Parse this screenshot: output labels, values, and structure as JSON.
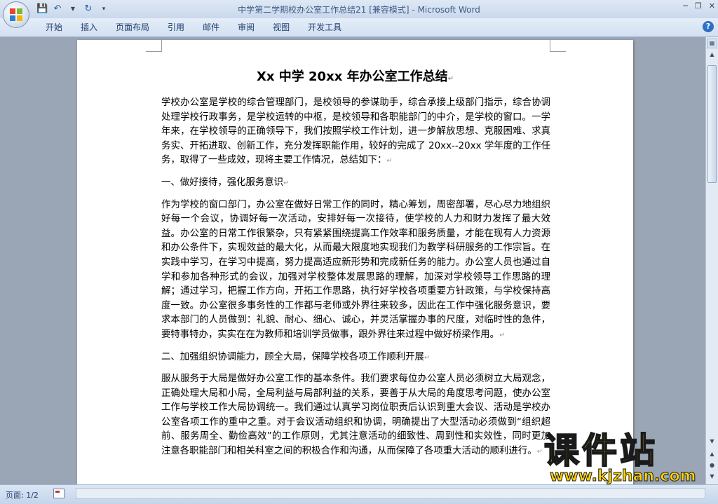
{
  "window": {
    "title": "中学第二学期校办公室工作总结21 [兼容模式]",
    "app_name": "Microsoft Word",
    "separator": " - "
  },
  "ribbon": {
    "tabs": [
      "开始",
      "插入",
      "页面布局",
      "引用",
      "邮件",
      "审阅",
      "视图",
      "开发工具"
    ]
  },
  "document": {
    "title": "Xx 中学 20xx 年办公室工作总结",
    "paragraphs": [
      "学校办公室是学校的综合管理部门，是校领导的参谋助手，综合承接上级部门指示，综合协调处理学校行政事务，是学校运转的中枢，是校领导和各职能部门的中介，是学校的窗口。一学年来，在学校领导的正确领导下，我们按照学校工作计划，进一步解放思想、克服困难、求真务实、开拓进取、创新工作，充分发挥职能作用，较好的完成了 20xx--20xx 学年度的工作任务，取得了一些成效，现将主要工作情况，总结如下：",
      "一、做好接待，强化服务意识",
      "作为学校的窗口部门，办公室在做好日常工作的同时，精心筹划，周密部署，尽心尽力地组织好每一个会议，协调好每一次活动，安排好每一次接待，使学校的人力和财力发挥了最大效益。办公室的日常工作很繁杂，只有紧紧围绕提高工作效率和服务质量，才能在现有人力资源和办公条件下，实现效益的最大化，从而最大限度地实现我们为教学科研服务的工作宗旨。在实践中学习，在学习中提高，努力提高适应新形势和完成新任务的能力。办公室人员也通过自学和参加各种形式的会议，加强对学校整体发展思路的理解，加深对学校领导工作思路的理解；通过学习，把握工作方向，开拓工作思路，执行好学校各项重要方针政策，与学校保持高度一致。办公室很多事务性的工作都与老师或外界往来较多，因此在工作中强化服务意识，要求本部门的人员做到：礼貌、耐心、细心、诚心，并灵活掌握办事的尺度，对临时性的急件，要特事特办，实实在在为教师和培训学员做事，跟外界往来过程中做好桥梁作用。",
      "二、加强组织协调能力，顾全大局，保障学校各项工作顺利开展",
      "服从服务于大局是做好办公室工作的基本条件。我们要求每位办公室人员必须树立大局观念，正确处理大局和小局，全局利益与局部利益的关系，要善于从大局的角度思考问题，使办公室工作与学校工作大局协调统一。我们通过认真学习岗位职责后认识到重大会议、活动是学校办公室各项工作的重中之重。对于会议活动组织和协调，明确提出了大型活动必须做到“组织超前、服务周全、勤俭高效”的工作原则，尤其注意活动的细致性、周到性和实效性，同时更加注意各职能部门和相关科室之间的积极合作和沟通，从而保障了各项重大活动的顺利进行。"
    ],
    "paragraph_mark": "↵"
  },
  "status": {
    "page_count": "页面: 1/2"
  },
  "watermark": {
    "main": "课件站",
    "url": "www.kjzhan.com"
  }
}
